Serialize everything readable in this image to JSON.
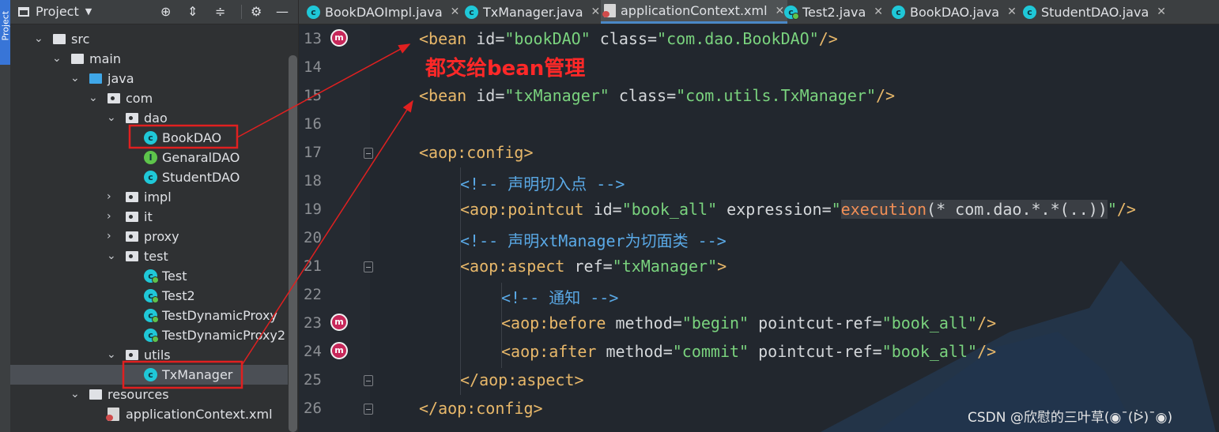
{
  "sidebar_strip": {
    "label": "Project"
  },
  "project_panel": {
    "title": "Project",
    "tree": [
      {
        "label": "src",
        "icon": "folder-icon",
        "arrow": "⌄"
      },
      {
        "label": "main",
        "icon": "folder-icon",
        "arrow": "⌄"
      },
      {
        "label": "java",
        "icon": "source-folder-icon",
        "arrow": "⌄"
      },
      {
        "label": "com",
        "icon": "package-icon",
        "arrow": "⌄"
      },
      {
        "label": "dao",
        "icon": "package-icon",
        "arrow": "⌄"
      },
      {
        "label": "BookDAO",
        "icon": "class-icon",
        "arrow": ""
      },
      {
        "label": "GenaralDAO",
        "icon": "interface-icon",
        "arrow": ""
      },
      {
        "label": "StudentDAO",
        "icon": "class-icon",
        "arrow": ""
      },
      {
        "label": "impl",
        "icon": "package-icon",
        "arrow": "›"
      },
      {
        "label": "it",
        "icon": "package-icon",
        "arrow": "›"
      },
      {
        "label": "proxy",
        "icon": "package-icon",
        "arrow": "›"
      },
      {
        "label": "test",
        "icon": "package-icon",
        "arrow": "⌄"
      },
      {
        "label": "Test",
        "icon": "runnable-class-icon",
        "arrow": ""
      },
      {
        "label": "Test2",
        "icon": "runnable-class-icon",
        "arrow": ""
      },
      {
        "label": "TestDynamicProxy",
        "icon": "runnable-class-icon",
        "arrow": ""
      },
      {
        "label": "TestDynamicProxy2",
        "icon": "runnable-class-icon",
        "arrow": ""
      },
      {
        "label": "utils",
        "icon": "package-icon",
        "arrow": "⌄"
      },
      {
        "label": "TxManager",
        "icon": "class-icon",
        "arrow": ""
      },
      {
        "label": "resources",
        "icon": "resources-folder-icon",
        "arrow": "⌄"
      },
      {
        "label": "applicationContext.xml",
        "icon": "xml-file-icon",
        "arrow": ""
      }
    ]
  },
  "tabs": [
    {
      "label": "BookDAOImpl.java",
      "icon": "class-icon",
      "active": false
    },
    {
      "label": "TxManager.java",
      "icon": "class-icon",
      "active": false
    },
    {
      "label": "applicationContext.xml",
      "icon": "xml-file-icon",
      "active": true
    },
    {
      "label": "Test2.java",
      "icon": "runnable-class-icon",
      "active": false
    },
    {
      "label": "BookDAO.java",
      "icon": "class-icon",
      "active": false
    },
    {
      "label": "StudentDAO.java",
      "icon": "class-icon",
      "active": false
    }
  ],
  "editor": {
    "line_numbers": [
      "13",
      "14",
      "15",
      "16",
      "17",
      "18",
      "19",
      "20",
      "21",
      "22",
      "23",
      "24",
      "25",
      "26"
    ],
    "lines": [
      [
        {
          "t": "<bean ",
          "k": "t"
        },
        {
          "t": "id=",
          "k": "a"
        },
        {
          "t": "\"bookDAO\"",
          "k": "v"
        },
        {
          "t": " class=",
          "k": "a"
        },
        {
          "t": "\"com.dao.BookDAO\"",
          "k": "v"
        },
        {
          "t": "/>",
          "k": "t"
        }
      ],
      [],
      [
        {
          "t": "<bean ",
          "k": "t"
        },
        {
          "t": "id=",
          "k": "a"
        },
        {
          "t": "\"txManager\"",
          "k": "v"
        },
        {
          "t": " class=",
          "k": "a"
        },
        {
          "t": "\"com.utils.TxManager\"",
          "k": "v"
        },
        {
          "t": "/>",
          "k": "t"
        }
      ],
      [],
      [
        {
          "t": "<aop:config>",
          "k": "t"
        }
      ],
      [
        {
          "t": "<!-- 声明切入点 -->",
          "k": "c"
        }
      ],
      [
        {
          "t": "<aop:pointcut ",
          "k": "t"
        },
        {
          "t": "id=",
          "k": "a"
        },
        {
          "t": "\"book_all\"",
          "k": "v"
        },
        {
          "t": " expression=",
          "k": "a"
        },
        {
          "t": "\"",
          "k": "v"
        },
        {
          "t": "execution",
          "k": "f",
          "hl": true
        },
        {
          "t": "(* com.dao.*.*(..))",
          "k": "a",
          "hl": true
        },
        {
          "t": "\"",
          "k": "v"
        },
        {
          "t": "/>",
          "k": "t"
        }
      ],
      [
        {
          "t": "<!-- 声明xtManager为切面类 -->",
          "k": "c"
        }
      ],
      [
        {
          "t": "<aop:aspect ",
          "k": "t"
        },
        {
          "t": "ref=",
          "k": "a"
        },
        {
          "t": "\"txManager\"",
          "k": "v"
        },
        {
          "t": ">",
          "k": "t"
        }
      ],
      [
        {
          "t": "<!-- 通知 -->",
          "k": "c"
        }
      ],
      [
        {
          "t": "<aop:before ",
          "k": "t"
        },
        {
          "t": "method=",
          "k": "a"
        },
        {
          "t": "\"begin\"",
          "k": "v"
        },
        {
          "t": " pointcut-ref=",
          "k": "a"
        },
        {
          "t": "\"book_all\"",
          "k": "v"
        },
        {
          "t": "/>",
          "k": "t"
        }
      ],
      [
        {
          "t": "<aop:after ",
          "k": "t"
        },
        {
          "t": "method=",
          "k": "a"
        },
        {
          "t": "\"commit\"",
          "k": "v"
        },
        {
          "t": " pointcut-ref=",
          "k": "a"
        },
        {
          "t": "\"book_all\"",
          "k": "v"
        },
        {
          "t": "/>",
          "k": "t"
        }
      ],
      [
        {
          "t": "</aop:aspect>",
          "k": "t"
        }
      ],
      [
        {
          "t": "</aop:config>",
          "k": "t"
        }
      ]
    ],
    "gutter_marks": [
      {
        "line": "13",
        "icon": "aop-method-marker-icon",
        "letter": "m"
      },
      {
        "line": "23",
        "icon": "aop-method-marker-icon",
        "letter": "m"
      },
      {
        "line": "24",
        "icon": "aop-method-marker-icon",
        "letter": "m"
      }
    ]
  },
  "annotation": "都交给bean管理",
  "watermark": "CSDN @欣慰的三叶草(◉¯(ᐖ)¯◉)",
  "colors": {
    "annotation_red": "#ff2828",
    "tag": "#e8b86a",
    "string": "#7ad37e",
    "comment": "#5aa9e6"
  }
}
